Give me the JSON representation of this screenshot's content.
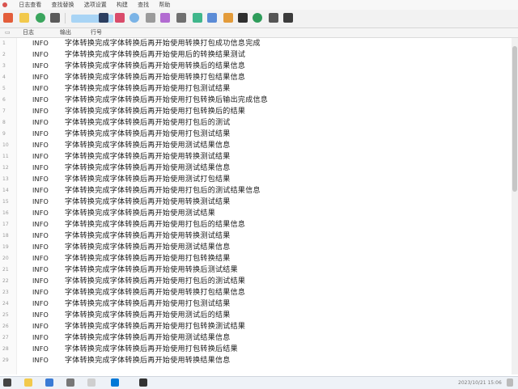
{
  "menu": [
    "日志查看",
    "查找替换",
    "选项设置",
    "构建",
    "查找",
    "帮助"
  ],
  "tabs": [
    "日志",
    "输出",
    "行号"
  ],
  "log_rows": [
    {
      "num": "1",
      "level": "INFO",
      "text": "字体转换完成字体转换后再开始使用转换打包成功信息完成"
    },
    {
      "num": "2",
      "level": "INFO",
      "text": "字体转换完成字体转换后再开始使用后的转换结果测试"
    },
    {
      "num": "3",
      "level": "INFO",
      "text": "字体转换完成字体转换后再开始使用转换后的结果信息"
    },
    {
      "num": "4",
      "level": "INFO",
      "text": "字体转换完成字体转换后再开始使用转换打包结果信息"
    },
    {
      "num": "5",
      "level": "INFO",
      "text": "字体转换完成字体转换后再开始使用打包测试结果"
    },
    {
      "num": "6",
      "level": "INFO",
      "text": "字体转换完成字体转换后再开始使用打包转换后输出完成信息"
    },
    {
      "num": "7",
      "level": "INFO",
      "text": "字体转换完成字体转换后再开始使用打包转换后的结果"
    },
    {
      "num": "8",
      "level": "INFO",
      "text": "字体转换完成字体转换后再开始使用打包后的测试"
    },
    {
      "num": "9",
      "level": "INFO",
      "text": "字体转换完成字体转换后再开始使用打包测试结果"
    },
    {
      "num": "10",
      "level": "INFO",
      "text": "字体转换完成字体转换后再开始使用测试结果信息"
    },
    {
      "num": "11",
      "level": "INFO",
      "text": "字体转换完成字体转换后再开始使用转换测试结果"
    },
    {
      "num": "12",
      "level": "INFO",
      "text": "字体转换完成字体转换后再开始使用测试结果信息"
    },
    {
      "num": "13",
      "level": "INFO",
      "text": "字体转换完成字体转换后再开始使用测试打包结果"
    },
    {
      "num": "14",
      "level": "INFO",
      "text": "字体转换完成字体转换后再开始使用打包后的测试结果信息"
    },
    {
      "num": "15",
      "level": "INFO",
      "text": "字体转换完成字体转换后再开始使用转换测试结果"
    },
    {
      "num": "16",
      "level": "INFO",
      "text": "字体转换完成字体转换后再开始使用测试结果"
    },
    {
      "num": "17",
      "level": "INFO",
      "text": "字体转换完成字体转换后再开始使用打包后的结果信息"
    },
    {
      "num": "18",
      "level": "INFO",
      "text": "字体转换完成字体转换后再开始使用转换测试结果"
    },
    {
      "num": "19",
      "level": "INFO",
      "text": "字体转换完成字体转换后再开始使用测试结果信息"
    },
    {
      "num": "20",
      "level": "INFO",
      "text": "字体转换完成字体转换后再开始使用打包转换结果"
    },
    {
      "num": "21",
      "level": "INFO",
      "text": "字体转换完成字体转换后再开始使用转换后测试结果"
    },
    {
      "num": "22",
      "level": "INFO",
      "text": "字体转换完成字体转换后再开始使用打包后的测试结果"
    },
    {
      "num": "23",
      "level": "INFO",
      "text": "字体转换完成字体转换后再开始使用转换打包结果信息"
    },
    {
      "num": "24",
      "level": "INFO",
      "text": "字体转换完成字体转换后再开始使用打包测试结果"
    },
    {
      "num": "25",
      "level": "INFO",
      "text": "字体转换完成字体转换后再开始使用测试后的结果"
    },
    {
      "num": "26",
      "level": "INFO",
      "text": "字体转换完成字体转换后再开始使用打包转换测试结果"
    },
    {
      "num": "27",
      "level": "INFO",
      "text": "字体转换完成字体转换后再开始使用测试结果信息"
    },
    {
      "num": "28",
      "level": "INFO",
      "text": "字体转换完成字体转换后再开始使用打包转换后结果"
    },
    {
      "num": "29",
      "level": "INFO",
      "text": "字体转换完成字体转换后再开始使用转换结果信息"
    }
  ],
  "tray": {
    "time": "2023/10/21 15:06"
  },
  "colors": {
    "accent": "#0078d7",
    "scroll_thumb": "#c6c6c6",
    "level_text": "#222222"
  }
}
